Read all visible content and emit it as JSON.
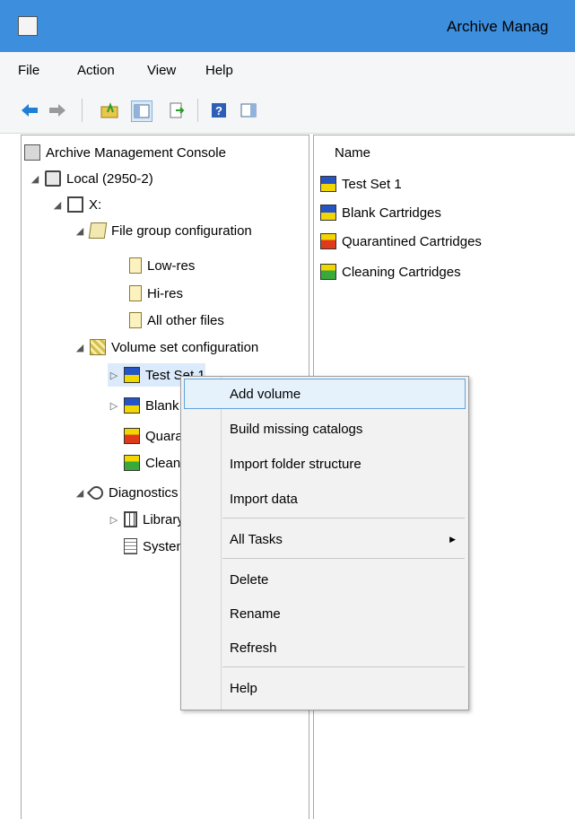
{
  "window": {
    "title": "Archive Manag"
  },
  "menubar": {
    "items": [
      "File",
      "Action",
      "View",
      "Help"
    ]
  },
  "toolbar": {
    "buttons": [
      "back-arrow-icon",
      "forward-arrow-icon",
      "up-folder-icon",
      "show-hide-tree-icon",
      "export-list-icon",
      "help-icon",
      "show-action-pane-icon"
    ]
  },
  "tree": {
    "root": "Archive Management Console",
    "local": "Local (2950-2)",
    "drive": "X:",
    "file_group": "File group configuration",
    "low_res": "Low-res",
    "hi_res": "Hi-res",
    "all_other": "All other files",
    "volume_set": "Volume set configuration",
    "test_set": "Test Set 1",
    "blank": "Blank Cartridges",
    "quarantined": "Quarantined Cartridges",
    "cleaning": "Cleaning Cartridges",
    "diagnostics": "Diagnostics",
    "library": "Library",
    "system": "System"
  },
  "list": {
    "column_name": "Name",
    "rows": [
      "Test Set 1",
      "Blank Cartridges",
      "Quarantined Cartridges",
      "Cleaning Cartridges"
    ]
  },
  "context_menu": {
    "add_volume": "Add volume",
    "build_catalogs": "Build missing catalogs",
    "import_folder": "Import folder structure",
    "import_data": "Import data",
    "all_tasks": "All Tasks",
    "delete": "Delete",
    "rename": "Rename",
    "refresh": "Refresh",
    "help": "Help"
  },
  "colors": {
    "titlebar": "#3e8ede",
    "menu_hover": "#e5f1fb",
    "menu_hover_border": "#5fa4de"
  }
}
